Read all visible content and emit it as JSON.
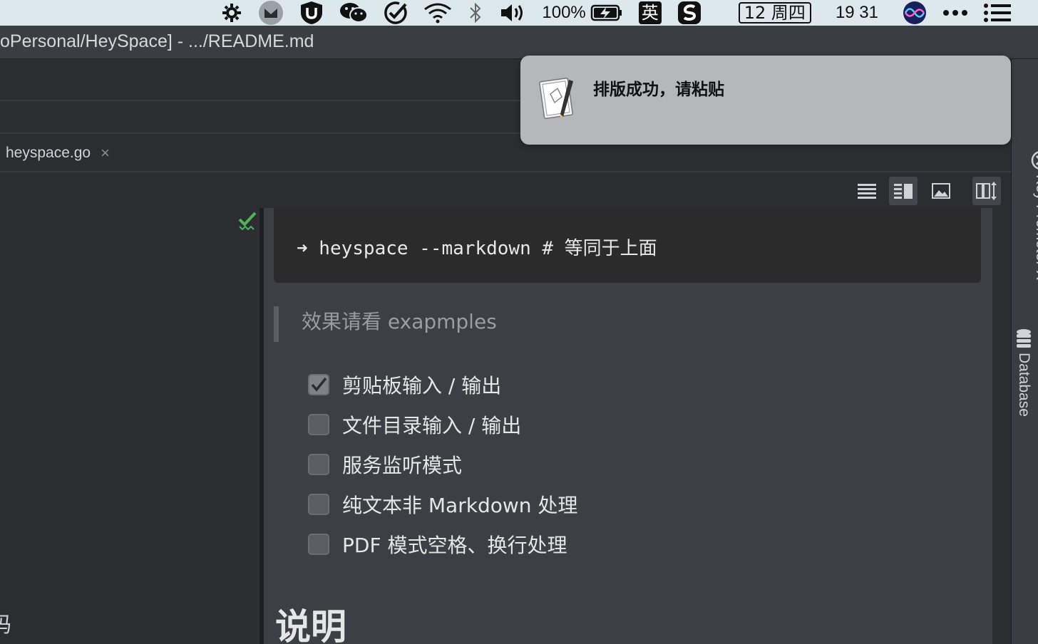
{
  "menubar": {
    "battery_percent": "100%",
    "input_method": "英",
    "date": "12 周四",
    "time": "19 31"
  },
  "window": {
    "title": "oPersonal/HeySpace] - .../README.md"
  },
  "tab": {
    "label": "heyspace.go",
    "close": "×"
  },
  "editor": {
    "left_fragment": "码"
  },
  "preview": {
    "code_line": "➜ heyspace --markdown # 等同于上面",
    "quote": "效果请看 exapmples",
    "tasks": [
      {
        "label": "剪贴板输入 / 输出",
        "checked": true
      },
      {
        "label": "文件目录输入 / 输出",
        "checked": false
      },
      {
        "label": "服务监听模式",
        "checked": false
      },
      {
        "label": "纯文本非 Markdown 处理",
        "checked": false
      },
      {
        "label": "PDF 模式空格、换行处理",
        "checked": false
      }
    ],
    "heading": "说明"
  },
  "right_tools": {
    "key_promoter": "Key Promoter X",
    "database": "Database"
  },
  "notification": {
    "message": "排版成功，请粘贴"
  },
  "colors": {
    "accent_check": "#4fb35a",
    "preview_bg": "#3c3f43",
    "notification_bg": "#b6b7ba"
  }
}
